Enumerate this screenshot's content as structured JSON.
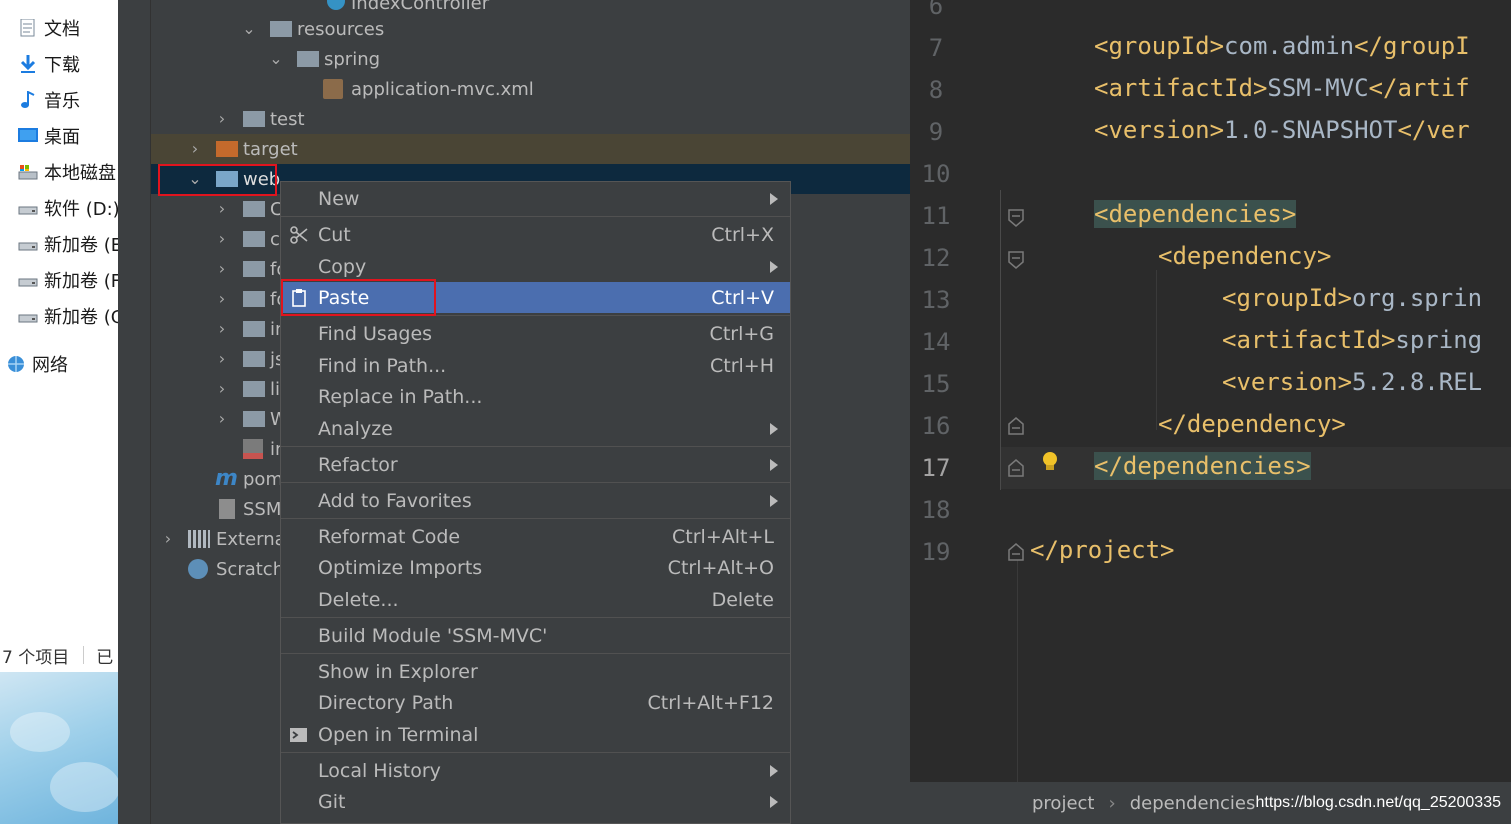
{
  "explorer": {
    "items": [
      {
        "label": "文档",
        "icon": "documents-icon"
      },
      {
        "label": "下载",
        "icon": "download-icon"
      },
      {
        "label": "音乐",
        "icon": "music-icon"
      },
      {
        "label": "桌面",
        "icon": "desktop-icon"
      },
      {
        "label": "本地磁盘",
        "icon": "local-disk-icon"
      },
      {
        "label": "软件 (D:)",
        "icon": "drive-icon"
      },
      {
        "label": "新加卷 (E",
        "icon": "drive-icon"
      },
      {
        "label": "新加卷 (F",
        "icon": "drive-icon"
      },
      {
        "label": "新加卷 (G",
        "icon": "drive-icon"
      },
      {
        "label": "网络",
        "icon": "network-icon"
      }
    ],
    "status_count": "7 个项目",
    "status_extra": "已"
  },
  "project_tree": [
    {
      "label": "IndexController",
      "icon": "class-icon"
    },
    {
      "label": "resources",
      "icon": "resources-folder-icon"
    },
    {
      "label": "spring",
      "icon": "folder-icon"
    },
    {
      "label": "application-mvc.xml",
      "icon": "spring-xml-icon"
    },
    {
      "label": "test",
      "icon": "folder-icon"
    },
    {
      "label": "target",
      "icon": "excluded-folder-icon"
    },
    {
      "label": "web",
      "icon": "web-folder-icon"
    },
    {
      "label": "C",
      "icon": "folder-icon"
    },
    {
      "label": "c",
      "icon": "folder-icon"
    },
    {
      "label": "fo",
      "icon": "folder-icon"
    },
    {
      "label": "fo",
      "icon": "folder-icon"
    },
    {
      "label": "in",
      "icon": "folder-icon"
    },
    {
      "label": "js",
      "icon": "folder-icon"
    },
    {
      "label": "li",
      "icon": "folder-icon"
    },
    {
      "label": "W",
      "icon": "folder-icon"
    },
    {
      "label": "in",
      "icon": "jsp-file-icon"
    },
    {
      "label": "pom",
      "icon": "maven-icon"
    },
    {
      "label": "SSM",
      "icon": "iml-file-icon"
    },
    {
      "label": "Externa",
      "icon": "libraries-icon"
    },
    {
      "label": "Scratch",
      "icon": "scratches-icon"
    }
  ],
  "context_menu": [
    {
      "label": "New",
      "shortcut": "",
      "submenu": true
    },
    {
      "label": "Cut",
      "shortcut": "Ctrl+X",
      "submenu": false,
      "icon": "scissors-icon"
    },
    {
      "label": "Copy",
      "shortcut": "",
      "submenu": true
    },
    {
      "label": "Paste",
      "shortcut": "Ctrl+V",
      "submenu": false,
      "icon": "clipboard-icon",
      "active": true
    },
    {
      "label": "Find Usages",
      "shortcut": "Ctrl+G",
      "submenu": false
    },
    {
      "label": "Find in Path...",
      "shortcut": "Ctrl+H",
      "submenu": false
    },
    {
      "label": "Replace in Path...",
      "shortcut": "",
      "submenu": false
    },
    {
      "label": "Analyze",
      "shortcut": "",
      "submenu": true
    },
    {
      "label": "Refactor",
      "shortcut": "",
      "submenu": true
    },
    {
      "label": "Add to Favorites",
      "shortcut": "",
      "submenu": true
    },
    {
      "label": "Reformat Code",
      "shortcut": "Ctrl+Alt+L",
      "submenu": false
    },
    {
      "label": "Optimize Imports",
      "shortcut": "Ctrl+Alt+O",
      "submenu": false
    },
    {
      "label": "Delete...",
      "shortcut": "Delete",
      "submenu": false
    },
    {
      "label": "Build Module 'SSM-MVC'",
      "shortcut": "",
      "submenu": false
    },
    {
      "label": "Show in Explorer",
      "shortcut": "",
      "submenu": false
    },
    {
      "label": "Directory Path",
      "shortcut": "Ctrl+Alt+F12",
      "submenu": false
    },
    {
      "label": "Open in Terminal",
      "shortcut": "",
      "submenu": false,
      "icon": "terminal-icon"
    },
    {
      "label": "Local History",
      "shortcut": "",
      "submenu": true
    },
    {
      "label": "Git",
      "shortcut": "",
      "submenu": true
    }
  ],
  "editor": {
    "line_numbers": [
      "6",
      "7",
      "8",
      "9",
      "10",
      "11",
      "12",
      "13",
      "14",
      "15",
      "16",
      "17",
      "18",
      "19"
    ],
    "current_line": "17",
    "lines": [
      {
        "tag_open": "<groupId>",
        "text": "com.admin",
        "tag_close": "</groupI"
      },
      {
        "tag_open": "<artifactId>",
        "text": "SSM-MVC",
        "tag_close": "</artif"
      },
      {
        "tag_open": "<version>",
        "text": "1.0-SNAPSHOT",
        "tag_close": "</ver"
      },
      {
        "tag_open": "<dependencies>",
        "text": "",
        "tag_close": ""
      },
      {
        "tag_open": "<dependency>",
        "text": "",
        "tag_close": ""
      },
      {
        "tag_open": "<groupId>",
        "text": "org.sprin",
        "tag_close": ""
      },
      {
        "tag_open": "<artifactId>",
        "text": "spring",
        "tag_close": ""
      },
      {
        "tag_open": "<version>",
        "text": "5.2.8.REL",
        "tag_close": ""
      },
      {
        "tag_open": "</dependency>",
        "text": "",
        "tag_close": ""
      },
      {
        "tag_open": "</dependencies>",
        "text": "",
        "tag_close": ""
      },
      {
        "tag_open": "</project>",
        "text": "",
        "tag_close": ""
      }
    ]
  },
  "breadcrumb": {
    "items": [
      "project",
      "dependencies"
    ],
    "separator": "›"
  },
  "watermark": "https://blog.csdn.net/qq_25200335",
  "colors": {
    "menu_active": "#4b6eaf",
    "highlight_box": "#e0141e",
    "tag": "#e8bf6a",
    "text": "#a9b7c6"
  }
}
